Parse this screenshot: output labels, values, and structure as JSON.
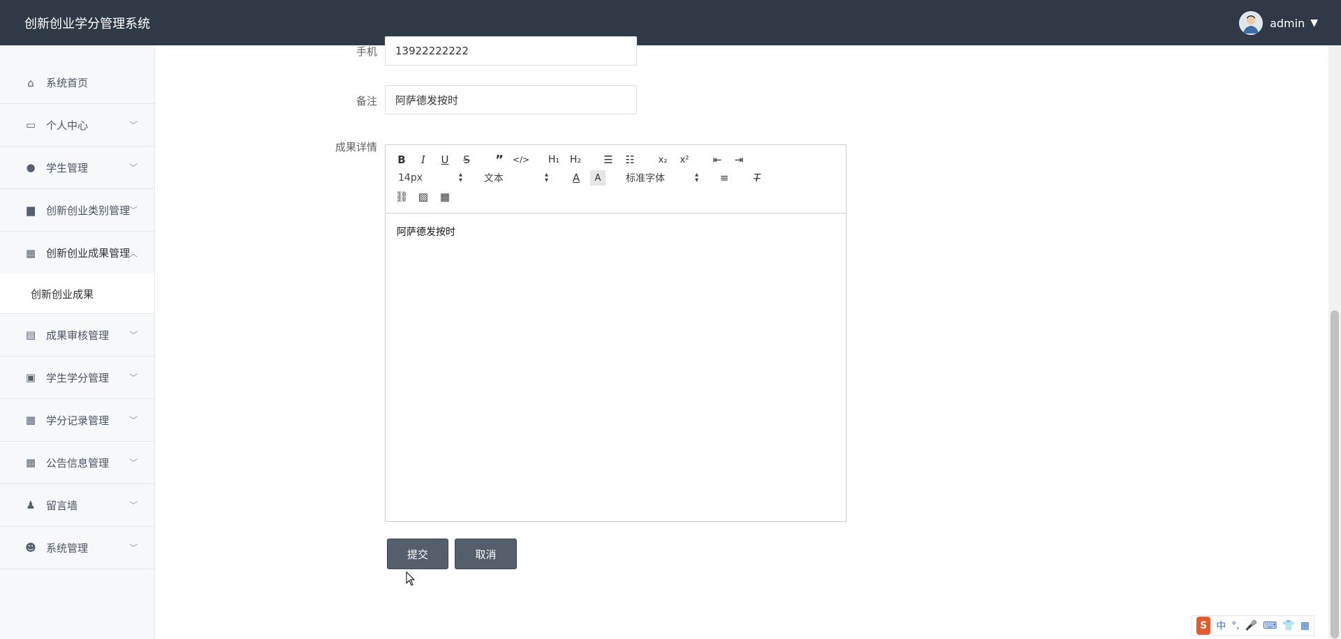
{
  "app": {
    "title": "创新创业学分管理系统"
  },
  "user": {
    "name": "admin",
    "caret": "▼"
  },
  "sidebar": {
    "items": [
      {
        "label": "系统首页",
        "icon": "home-icon",
        "glyph": "⌂",
        "chev": ""
      },
      {
        "label": "个人中心",
        "icon": "card-icon",
        "glyph": "▭",
        "chev": "﹀"
      },
      {
        "label": "学生管理",
        "icon": "bulb-icon",
        "glyph": "●",
        "chev": "﹀"
      },
      {
        "label": "创新创业类别管理",
        "icon": "briefcase-icon",
        "glyph": "▆",
        "chev": "﹀"
      },
      {
        "label": "创新创业成果管理",
        "icon": "grid-icon",
        "glyph": "▦",
        "chev": "︿"
      },
      {
        "label": "成果审核管理",
        "icon": "clipboard-icon",
        "glyph": "▤",
        "chev": "﹀"
      },
      {
        "label": "学生学分管理",
        "icon": "clipboard-x-icon",
        "glyph": "▣",
        "chev": "﹀"
      },
      {
        "label": "学分记录管理",
        "icon": "grid-icon",
        "glyph": "▦",
        "chev": "﹀"
      },
      {
        "label": "公告信息管理",
        "icon": "grid-icon",
        "glyph": "▦",
        "chev": "﹀"
      },
      {
        "label": "留言墙",
        "icon": "stamp-icon",
        "glyph": "♟",
        "chev": "﹀"
      },
      {
        "label": "系统管理",
        "icon": "user-icon",
        "glyph": "☻",
        "chev": "﹀"
      }
    ],
    "subitem": "创新创业成果"
  },
  "form": {
    "phone_label": "手机",
    "phone_value": "13922222222",
    "note_label": "备注",
    "note_value": "阿萨德发按时",
    "detail_label": "成果详情"
  },
  "editor": {
    "font_size": "14px",
    "block": "文本",
    "font_family": "标准字体",
    "h1": "H₁",
    "h2": "H₂",
    "content": "阿萨德发按时"
  },
  "buttons": {
    "submit": "提交",
    "cancel": "取消"
  },
  "ime": {
    "logo": "S",
    "lang": "中",
    "punct": "°,"
  }
}
